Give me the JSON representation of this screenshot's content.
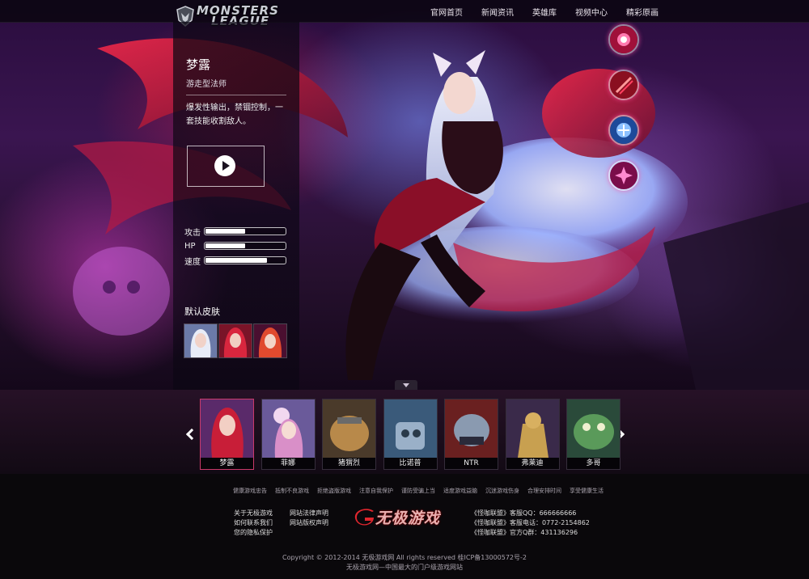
{
  "brand": {
    "logo_line1": "MONSTERS",
    "logo_line2": "LEAGUE"
  },
  "nav": {
    "items": [
      "官网首页",
      "新闻资讯",
      "英雄库",
      "视频中心",
      "精彩原画"
    ]
  },
  "hero": {
    "name": "梦露",
    "role": "游走型法师",
    "description": "爆发性输出，禁锢控制，一套技能收割敌人。",
    "stats": [
      {
        "label": "攻击",
        "fill": 0.5
      },
      {
        "label": "HP",
        "fill": 0.5
      },
      {
        "label": "速度",
        "fill": 0.78
      }
    ],
    "skin_title": "默认皮肤",
    "skins": [
      "skin-1",
      "skin-2",
      "skin-3"
    ]
  },
  "skills": [
    "charm-orb-icon",
    "spirit-rush-icon",
    "orb-deception-icon",
    "fox-fire-icon"
  ],
  "hero_list": {
    "items": [
      {
        "name": "梦露",
        "active": true
      },
      {
        "name": "菲娜",
        "active": false
      },
      {
        "name": "猪猬烈",
        "active": false
      },
      {
        "name": "比诺普",
        "active": false
      },
      {
        "name": "NTR",
        "active": false
      },
      {
        "name": "弗莱迪",
        "active": false
      },
      {
        "name": "多哥",
        "active": false
      }
    ]
  },
  "footer": {
    "links": [
      "健康游戏忠告",
      "抵制不良游戏",
      "拒绝盗版游戏",
      "注意自我保护",
      "谨防受骗上当",
      "适度游戏益脑",
      "沉迷游戏伤身",
      "合理安排时间",
      "享受健康生活"
    ],
    "about": [
      "关于无极游戏",
      "如何联系我们",
      "您的隐私保护"
    ],
    "legal": [
      "网站法律声明",
      "网站版权声明"
    ],
    "brand_name": "无极游戏",
    "contact": [
      "《怪咖联盟》客服QQ：666666666",
      "《怪咖联盟》客服电话：0772-2154862",
      "《怪咖联盟》官方Q群：431136296"
    ],
    "copyright": "Copyright © 2012-2014 无极游戏网 All rights reserved  桂ICP备13000572号-2",
    "slogan": "无极游戏网—中国最大的门户级游戏网站"
  }
}
